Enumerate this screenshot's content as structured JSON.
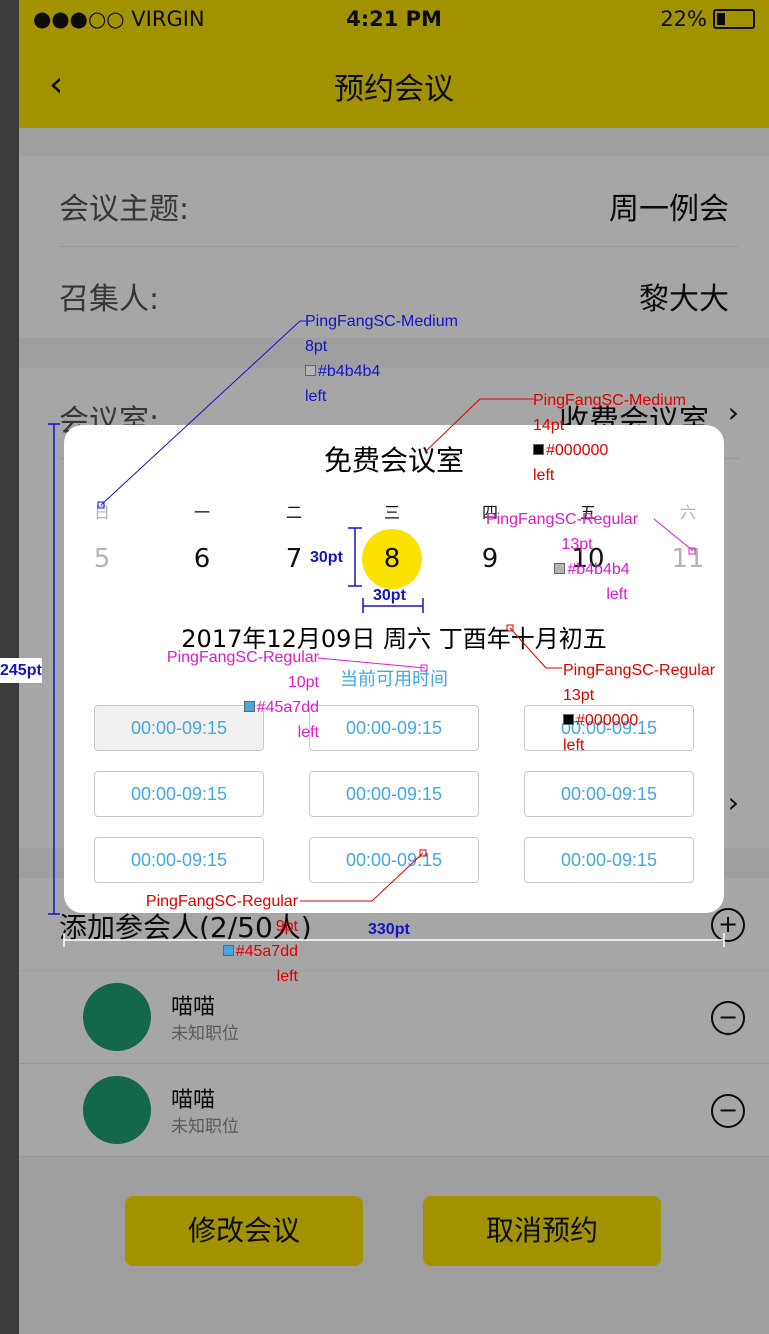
{
  "status_bar": {
    "carrier": "●●●○○ VIRGIN",
    "time": "4:21 PM",
    "battery": "22%",
    "battery_level": 0.22
  },
  "navbar": {
    "back_icon": "chevron-left-icon",
    "title": "预约会议"
  },
  "form": {
    "topic_label": "会议主题:",
    "topic_value": "周一例会",
    "host_label": "召集人:",
    "host_value": "黎大大",
    "room_label": "会议室:",
    "room_value": "收费会议室"
  },
  "attendees": {
    "label": "添加参会人(2/50人)",
    "items": [
      {
        "name": "喵喵",
        "role": "未知职位"
      },
      {
        "name": "喵喵",
        "role": "未知职位"
      }
    ]
  },
  "buttons": {
    "modify": "修改会议",
    "cancel": "取消预约"
  },
  "modal": {
    "title": "免费会议室",
    "weekdays": [
      "日",
      "一",
      "二",
      "三",
      "四",
      "五",
      "六"
    ],
    "days": [
      "5",
      "6",
      "7",
      "8",
      "9",
      "10",
      "11"
    ],
    "selected_day_index": 3,
    "date_line": "2017年12月09日   周六   丁酉年十月初五",
    "available_label": "当前可用时间",
    "slots": [
      "00:00-09:15",
      "00:00-09:15",
      "00:00-09:15",
      "00:00-09:15",
      "00:00-09:15",
      "00:00-09:15",
      "00:00-09:15",
      "00:00-09:15",
      "00:00-09:15"
    ]
  },
  "annotations": {
    "a1": [
      "PingFangSC-Medium",
      "8pt",
      "#b4b4b4",
      "left"
    ],
    "a2": [
      "PingFangSC-Medium",
      "14pt",
      "#000000",
      "left"
    ],
    "a3": [
      "PingFangSC-Regular",
      "13pt",
      "#b4b4b4",
      "left"
    ],
    "a4": [
      "PingFangSC-Regular",
      "10pt",
      "#45a7dd",
      "left"
    ],
    "a5": [
      "PingFangSC-Regular",
      "13pt",
      "#000000",
      "left"
    ],
    "a6": [
      "PingFangSC-Regular",
      "9pt",
      "#45a7dd",
      "left"
    ],
    "dim_30pt_h": "30pt",
    "dim_30pt_w": "30pt",
    "dim_245pt": "245pt",
    "dim_330pt": "330pt",
    "colors": {
      "blue": "#1414c8",
      "red": "#dd0000",
      "magenta": "#d81ccf"
    }
  }
}
